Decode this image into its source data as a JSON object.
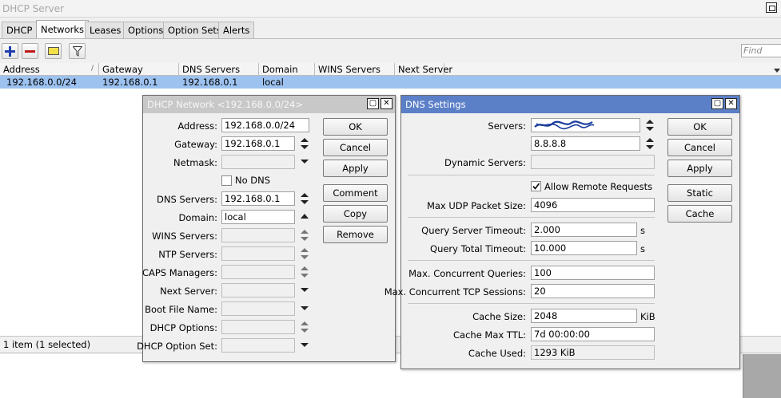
{
  "window": {
    "title": "DHCP Server"
  },
  "tabs": [
    "DHCP",
    "Networks",
    "Leases",
    "Options",
    "Option Sets",
    "Alerts"
  ],
  "toolbar": {
    "find_placeholder": "Find",
    "add_icon": "plus-icon",
    "remove_icon": "minus-icon",
    "comment_icon": "note-icon",
    "filter_icon": "filter-icon"
  },
  "table": {
    "columns": [
      "Address",
      "Gateway",
      "DNS Servers",
      "Domain",
      "WINS Servers",
      "Next Server"
    ],
    "rows": [
      {
        "address": "192.168.0.0/24",
        "gateway": "192.168.0.1",
        "dns": "192.168.0.1",
        "domain": "local",
        "wins": "",
        "next_server": ""
      }
    ]
  },
  "status": {
    "text": "1 item (1 selected)"
  },
  "network_dialog": {
    "title": "DHCP Network <192.168.0.0/24>",
    "labels": {
      "address": "Address:",
      "gateway": "Gateway:",
      "netmask": "Netmask:",
      "no_dns": "No DNS",
      "dns_servers": "DNS Servers:",
      "domain": "Domain:",
      "wins_servers": "WINS Servers:",
      "ntp_servers": "NTP Servers:",
      "caps_managers": "CAPS Managers:",
      "next_server": "Next Server:",
      "boot_file": "Boot File Name:",
      "dhcp_options": "DHCP Options:",
      "dhcp_option_set": "DHCP Option Set:"
    },
    "values": {
      "address": "192.168.0.0/24",
      "gateway": "192.168.0.1",
      "dns_servers": "192.168.0.1",
      "domain": "local"
    },
    "buttons": {
      "ok": "OK",
      "cancel": "Cancel",
      "apply": "Apply",
      "comment": "Comment",
      "copy": "Copy",
      "remove": "Remove"
    }
  },
  "dns_dialog": {
    "title": "DNS Settings",
    "labels": {
      "servers": "Servers:",
      "dynamic_servers": "Dynamic Servers:",
      "allow_remote": "Allow Remote Requests",
      "max_udp": "Max UDP Packet Size:",
      "query_server_timeout": "Query Server Timeout:",
      "query_total_timeout": "Query Total Timeout:",
      "max_concurrent_queries": "Max. Concurrent Queries:",
      "max_concurrent_tcp": "Max. Concurrent TCP Sessions:",
      "cache_size": "Cache Size:",
      "cache_max_ttl": "Cache Max TTL:",
      "cache_used": "Cache Used:"
    },
    "values": {
      "server2": "8.8.8.8",
      "max_udp": "4096",
      "query_server_timeout": "2.000",
      "query_total_timeout": "10.000",
      "max_concurrent_queries": "100",
      "max_concurrent_tcp": "20",
      "cache_size": "2048",
      "cache_max_ttl": "7d 00:00:00",
      "cache_used": "1293 KiB"
    },
    "units": {
      "s1": "s",
      "s2": "s",
      "kib": "KiB"
    },
    "allow_remote_checked": true,
    "buttons": {
      "ok": "OK",
      "cancel": "Cancel",
      "apply": "Apply",
      "static": "Static",
      "cache": "Cache"
    }
  }
}
